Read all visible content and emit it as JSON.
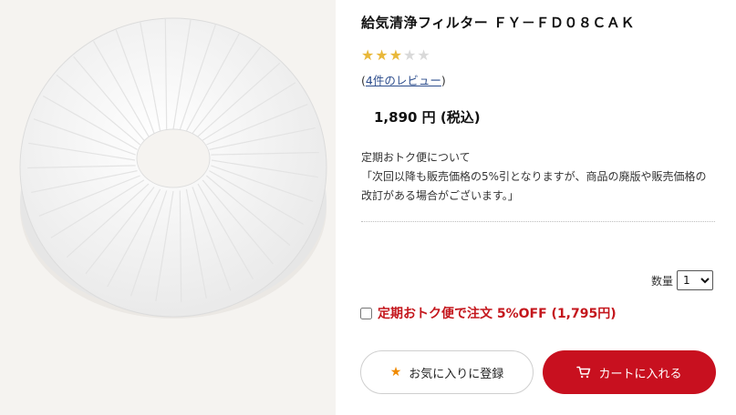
{
  "product": {
    "title": "給気清浄フィルター ＦＹ－ＦＤ０８ＣＡＫ",
    "rating": 3,
    "rating_max": 5,
    "review_link": {
      "open": "(",
      "text": "4件のレビュー",
      "close": ")"
    },
    "price": "1,890 円 (税込)"
  },
  "subscription_note": {
    "heading": "定期おトク便について",
    "body": "「次回以降も販売価格の5%引となりますが、商品の廃版や販売価格の改訂がある場合がございます。」"
  },
  "quantity": {
    "label": "数量",
    "value": "1"
  },
  "subscribe_option": {
    "label": "定期おトク便で注文 5%OFF (1,795円)",
    "checked": false
  },
  "buttons": {
    "favorite": "お気に入りに登録",
    "cart": "カートに入れる"
  },
  "colors": {
    "accent": "#c8101f",
    "star": "#e9b83a",
    "favorite_star": "#f08a00"
  }
}
